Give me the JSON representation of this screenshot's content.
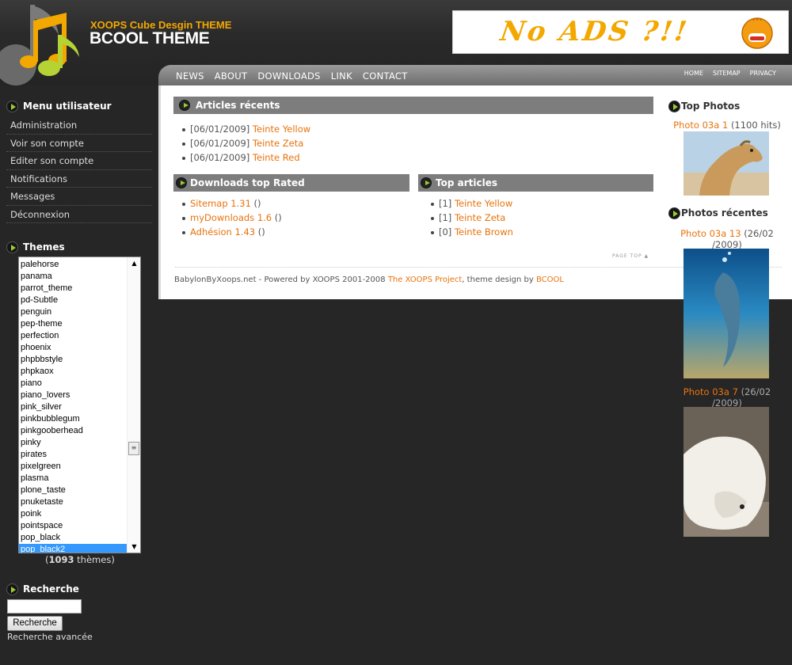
{
  "header": {
    "logo_subtitle": "XOOPS Cube Desgin THEME",
    "logo_title": "BCOOL THEME",
    "banner_text": "No ADS ?!!"
  },
  "nav": {
    "main": [
      "NEWS",
      "ABOUT",
      "DOWNLOADS",
      "LINK",
      "CONTACT"
    ],
    "right": [
      "HOME",
      "SITEMAP",
      "PRIVACY"
    ]
  },
  "sidebar": {
    "user_menu_title": "Menu utilisateur",
    "user_menu": [
      "Administration",
      "Voir son compte",
      "Editer son compte",
      "Notifications",
      "Messages",
      "Déconnexion"
    ],
    "themes_title": "Themes",
    "themes": [
      "palehorse",
      "panama",
      "parrot_theme",
      "pd-Subtle",
      "penguin",
      "pep-theme",
      "perfection",
      "phoenix",
      "phpbbstyle",
      "phpkaox",
      "piano",
      "piano_lovers",
      "pink_silver",
      "pinkbubblegum",
      "pinkgooberhead",
      "pinky",
      "pirates",
      "pixelgreen",
      "plasma",
      "plone_taste",
      "pnuketaste",
      "poink",
      "pointspace",
      "pop_black",
      "pop_black2"
    ],
    "themes_selected": "pop_black2",
    "themes_count_pre": "(",
    "themes_count": "1093",
    "themes_count_post": " thèmes)",
    "search_title": "Recherche",
    "search_value": "",
    "search_button": "Recherche",
    "advanced_search": "Recherche avancée"
  },
  "main": {
    "recent_articles": {
      "title": "Articles récents",
      "items": [
        {
          "date": "[06/01/2009]",
          "link": "Teinte Yellow"
        },
        {
          "date": "[06/01/2009]",
          "link": "Teinte Zeta"
        },
        {
          "date": "[06/01/2009]",
          "link": "Teinte Red"
        }
      ]
    },
    "downloads": {
      "title": "Downloads top Rated",
      "items": [
        {
          "link": "Sitemap 1.31",
          "suffix": "()"
        },
        {
          "link": "myDownloads 1.6",
          "suffix": "()"
        },
        {
          "link": "Adhésion 1.43",
          "suffix": "()"
        }
      ]
    },
    "top_articles": {
      "title": "Top articles",
      "items": [
        {
          "count": "[1]",
          "link": "Teinte Yellow"
        },
        {
          "count": "[1]",
          "link": "Teinte Zeta"
        },
        {
          "count": "[0]",
          "link": "Teinte Brown"
        }
      ]
    },
    "page_top": "PAGE TOP",
    "footer": {
      "prefix": "BabylonByXoops.net - Powered by XOOPS 2001-2008 ",
      "project_link": "The XOOPS Project",
      "middle": ", theme design by ",
      "designer_link": "BCOOL"
    }
  },
  "right": {
    "top_photos_title": "Top Photos",
    "top_photo": {
      "link": "Photo 03a 1",
      "info": "(1100 hits)"
    },
    "recent_title": "Photos récentes",
    "recent": [
      {
        "link": "Photo 03a 13",
        "date1": "(26/02",
        "date2": "/2009)"
      },
      {
        "link": "Photo 03a 7",
        "date1": "(26/02",
        "date2": "/2009)"
      }
    ]
  },
  "colors": {
    "accent": "#e8730d",
    "logo_sub": "#f3a800",
    "background": "#262626",
    "nav": "#7d7d7d",
    "selection": "#3399ff"
  }
}
